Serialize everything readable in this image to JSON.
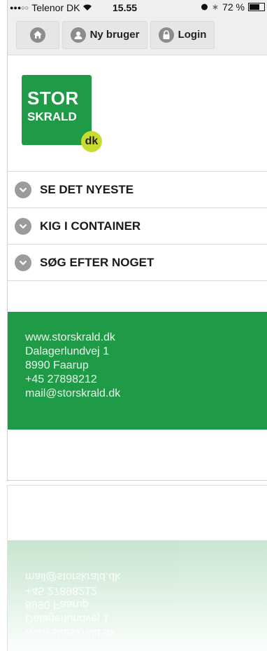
{
  "status": {
    "carrier": "Telenor DK",
    "time": "15.55",
    "battery": "72 %",
    "battery_level": 0.72
  },
  "nav": {
    "home_icon": "home-icon",
    "new_user_label": "Ny bruger",
    "login_label": "Login"
  },
  "logo": {
    "line1": "STOR",
    "line2": "SKRALD",
    "badge": "dk"
  },
  "menu": {
    "items": [
      {
        "label": "SE DET NYESTE"
      },
      {
        "label": "KIG I CONTAINER"
      },
      {
        "label": "SØG EFTER NOGET"
      }
    ]
  },
  "footer": {
    "website": "www.storskrald.dk",
    "street": "Dalagerlundvej 1",
    "city": "8990 Faarup",
    "phone": "+45 27898212",
    "email": "mail@storskrald.dk"
  },
  "colors": {
    "brand_green": "#1f9a47",
    "badge_lime": "#c8dc2e"
  }
}
